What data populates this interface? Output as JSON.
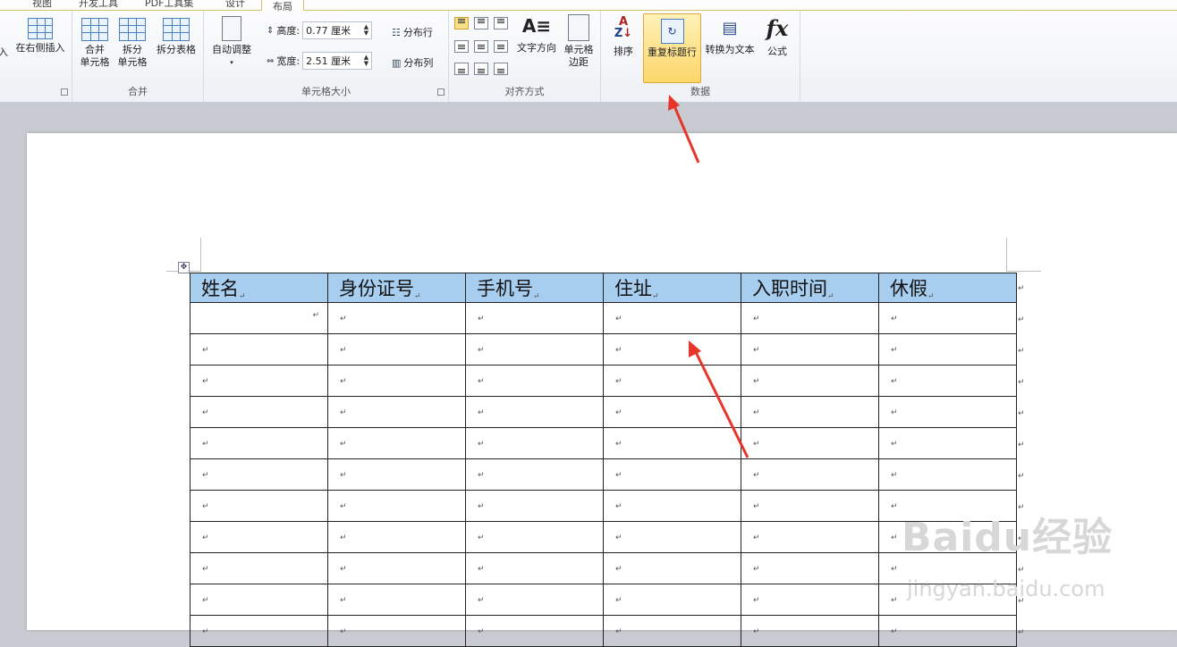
{
  "tabs": [
    "视图",
    "开发工具",
    "PDF工具集",
    "设计",
    "布局"
  ],
  "ribbon": {
    "rows_cols": {
      "insert_left_partial": "入",
      "insert_right": "在右侧插入"
    },
    "merge_group": {
      "label": "合并",
      "merge_cells": [
        "合并",
        "单元格"
      ],
      "split_cells": [
        "拆分",
        "单元格"
      ],
      "split_table": "拆分表格"
    },
    "cell_size_group": {
      "label": "单元格大小",
      "autofit": "自动调整",
      "height_label": "高度:",
      "height_value": "0.77 厘米",
      "width_label": "宽度:",
      "width_value": "2.51 厘米",
      "distribute_rows": "分布行",
      "distribute_cols": "分布列"
    },
    "alignment_group": {
      "label": "对齐方式",
      "text_direction": "文字方向",
      "cell_margins": [
        "单元格",
        "边距"
      ]
    },
    "data_group": {
      "label": "数据",
      "sort": "排序",
      "repeat_header": "重复标题行",
      "convert_to_text": "转换为文本",
      "formula": "公式",
      "formula_glyph": "fx"
    }
  },
  "table": {
    "headers": [
      "姓名",
      "身份证号",
      "手机号",
      "住址",
      "入职时间",
      "休假"
    ],
    "empty_rows": 11,
    "cell_mark": "↵"
  },
  "watermark": {
    "main": "Baidu经验",
    "sub": "jingyan.baidu.com"
  },
  "colors": {
    "header_fill": "#a7cdef",
    "arrow": "#e8352b",
    "highlight": "#fcd66a"
  }
}
